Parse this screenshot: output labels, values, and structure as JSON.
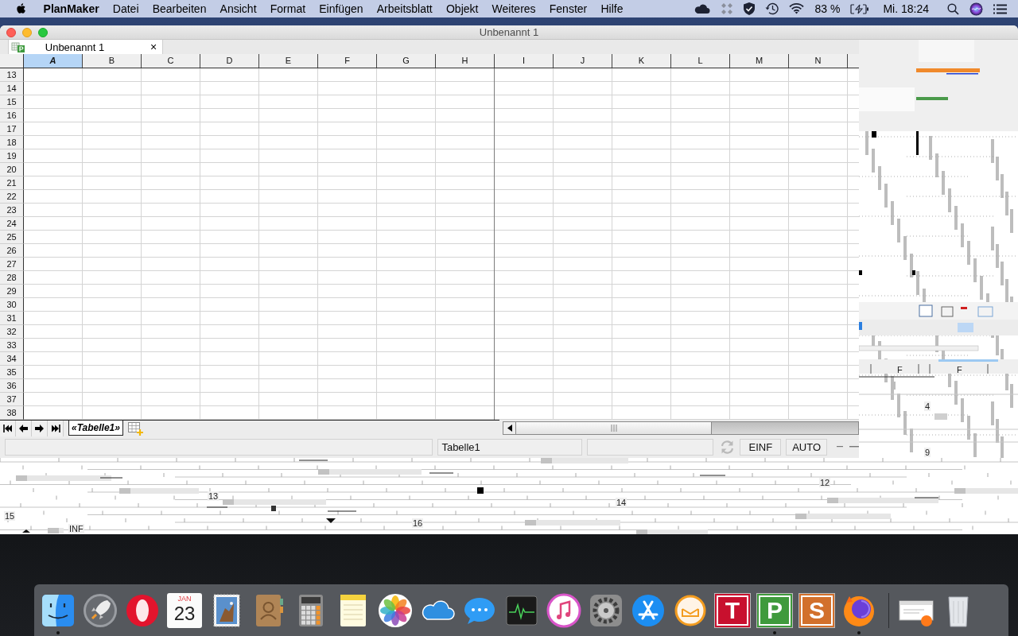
{
  "menu_bar": {
    "app_name": "PlanMaker",
    "menus": [
      "Datei",
      "Bearbeiten",
      "Ansicht",
      "Format",
      "Einfügen",
      "Arbeitsblatt",
      "Objekt",
      "Weiteres",
      "Fenster",
      "Hilfe"
    ],
    "battery": "83 %",
    "clock": "Mi. 18:24"
  },
  "window": {
    "title": "Unbenannt 1"
  },
  "document_tabs": [
    {
      "label": "Unbenannt 1",
      "close": "×",
      "selected": true
    }
  ],
  "sheet": {
    "columns": [
      {
        "label": "A",
        "selected": true
      },
      {
        "label": "B",
        "selected": false
      },
      {
        "label": "C",
        "selected": false
      },
      {
        "label": "D",
        "selected": false
      },
      {
        "label": "E",
        "selected": false
      },
      {
        "label": "F",
        "selected": false
      },
      {
        "label": "G",
        "selected": false
      },
      {
        "label": "H",
        "selected": false
      },
      {
        "label": "I",
        "selected": false
      },
      {
        "label": "J",
        "selected": false
      },
      {
        "label": "K",
        "selected": false
      },
      {
        "label": "L",
        "selected": false
      },
      {
        "label": "M",
        "selected": false
      },
      {
        "label": "N",
        "selected": false
      }
    ],
    "rows": [
      "13",
      "14",
      "15",
      "16",
      "17",
      "18",
      "19",
      "20",
      "21",
      "22",
      "23",
      "24",
      "25",
      "26",
      "27",
      "28",
      "29",
      "30",
      "31",
      "32",
      "33",
      "34",
      "35",
      "36",
      "37",
      "38"
    ]
  },
  "sheet_tabs": [
    {
      "label": "«Tabelle1»",
      "selected": true
    }
  ],
  "status_bar": {
    "sheet_name": "Tabelle1",
    "insert_mode": "EINF",
    "calc_mode": "AUTO"
  },
  "glitch": {
    "right_panel_texts": [
      "F",
      "F",
      "4",
      "9"
    ],
    "bottom_strip_texts": [
      "12",
      "13",
      "14",
      "15",
      "16",
      "INF"
    ]
  },
  "dock": {
    "apps": [
      {
        "kind": "finder",
        "running": true
      },
      {
        "kind": "launchpad",
        "running": false
      },
      {
        "kind": "opera",
        "running": false
      },
      {
        "kind": "calendar",
        "month": "JAN",
        "day": "23",
        "running": false
      },
      {
        "kind": "mail",
        "running": false
      },
      {
        "kind": "contacts",
        "running": false
      },
      {
        "kind": "calculator",
        "running": false
      },
      {
        "kind": "notes",
        "running": false
      },
      {
        "kind": "photos",
        "running": false
      },
      {
        "kind": "onedrive",
        "running": false
      },
      {
        "kind": "messages",
        "running": false
      },
      {
        "kind": "activity_monitor",
        "running": false
      },
      {
        "kind": "itunes",
        "running": false
      },
      {
        "kind": "system_preferences",
        "running": false
      },
      {
        "kind": "app_store",
        "running": false
      },
      {
        "kind": "email_client",
        "running": false
      },
      {
        "kind": "letter",
        "label": "T",
        "color": "#c8102e",
        "running": false
      },
      {
        "kind": "letter",
        "label": "P",
        "color": "#3f9a3c",
        "running": true
      },
      {
        "kind": "letter",
        "label": "S",
        "color": "#d2702c",
        "running": false
      },
      {
        "kind": "firefox",
        "running": true
      }
    ],
    "stacks": [
      {
        "kind": "window_preview"
      },
      {
        "kind": "trash"
      }
    ]
  }
}
